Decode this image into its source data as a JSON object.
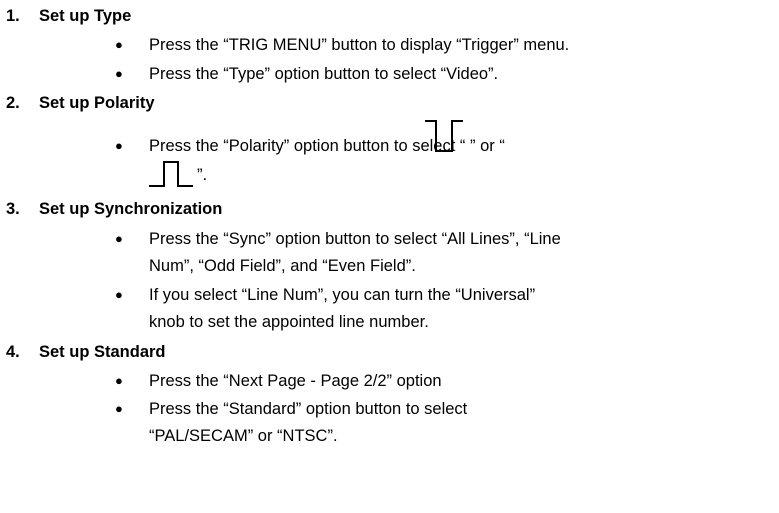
{
  "steps": [
    {
      "number": "1.",
      "title": "Set up Type",
      "bullets": [
        "Press the “TRIG MENU” button to display “Trigger” menu.",
        "Press the “Type” option button to select “Video”."
      ]
    },
    {
      "number": "2.",
      "title": "Set up Polarity",
      "bullets": [
        {
          "before": "Press the “Polarity” option button to select “",
          "icon_a": "negative-pulse-icon",
          "middle": "” or “",
          "icon_b": "positive-pulse-icon",
          "after": "”."
        }
      ]
    },
    {
      "number": "3.",
      "title": "Set up Synchronization",
      "bullets": [
        [
          "Press the “Sync” option button to select “All Lines”, “Line",
          "Num”, “Odd Field”, and “Even Field”."
        ],
        [
          "If you select “Line Num”, you can turn the “Universal”",
          "knob to set the appointed line number."
        ]
      ]
    },
    {
      "number": "4.",
      "title": "Set up Standard",
      "bullets": [
        "Press the “Next Page - Page 2/2” option",
        [
          "Press the “Standard” option button to select",
          "“PAL/SECAM” or “NTSC”."
        ]
      ]
    }
  ],
  "bullet_glyph": "●"
}
